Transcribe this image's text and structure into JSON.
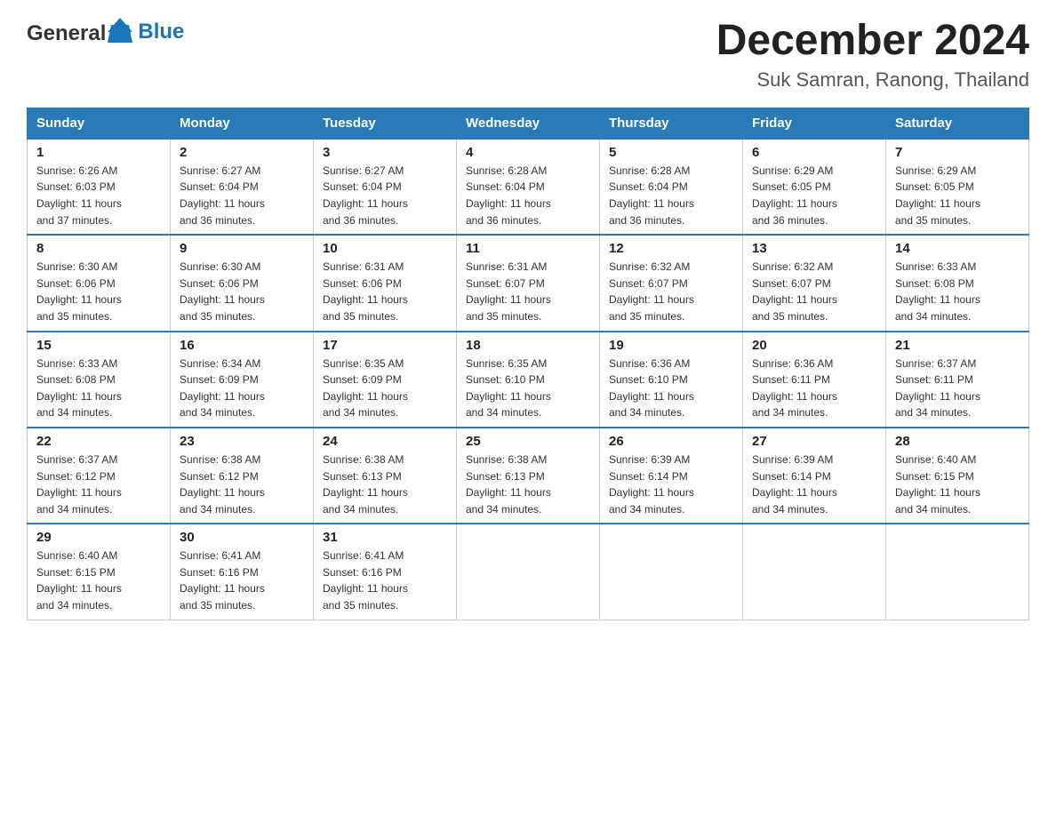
{
  "header": {
    "logo_general": "General",
    "logo_blue": "Blue",
    "title": "December 2024",
    "subtitle": "Suk Samran, Ranong, Thailand"
  },
  "days_of_week": [
    "Sunday",
    "Monday",
    "Tuesday",
    "Wednesday",
    "Thursday",
    "Friday",
    "Saturday"
  ],
  "weeks": [
    [
      {
        "day": "1",
        "sunrise": "6:26 AM",
        "sunset": "6:03 PM",
        "daylight": "11 hours and 37 minutes."
      },
      {
        "day": "2",
        "sunrise": "6:27 AM",
        "sunset": "6:04 PM",
        "daylight": "11 hours and 36 minutes."
      },
      {
        "day": "3",
        "sunrise": "6:27 AM",
        "sunset": "6:04 PM",
        "daylight": "11 hours and 36 minutes."
      },
      {
        "day": "4",
        "sunrise": "6:28 AM",
        "sunset": "6:04 PM",
        "daylight": "11 hours and 36 minutes."
      },
      {
        "day": "5",
        "sunrise": "6:28 AM",
        "sunset": "6:04 PM",
        "daylight": "11 hours and 36 minutes."
      },
      {
        "day": "6",
        "sunrise": "6:29 AM",
        "sunset": "6:05 PM",
        "daylight": "11 hours and 36 minutes."
      },
      {
        "day": "7",
        "sunrise": "6:29 AM",
        "sunset": "6:05 PM",
        "daylight": "11 hours and 35 minutes."
      }
    ],
    [
      {
        "day": "8",
        "sunrise": "6:30 AM",
        "sunset": "6:06 PM",
        "daylight": "11 hours and 35 minutes."
      },
      {
        "day": "9",
        "sunrise": "6:30 AM",
        "sunset": "6:06 PM",
        "daylight": "11 hours and 35 minutes."
      },
      {
        "day": "10",
        "sunrise": "6:31 AM",
        "sunset": "6:06 PM",
        "daylight": "11 hours and 35 minutes."
      },
      {
        "day": "11",
        "sunrise": "6:31 AM",
        "sunset": "6:07 PM",
        "daylight": "11 hours and 35 minutes."
      },
      {
        "day": "12",
        "sunrise": "6:32 AM",
        "sunset": "6:07 PM",
        "daylight": "11 hours and 35 minutes."
      },
      {
        "day": "13",
        "sunrise": "6:32 AM",
        "sunset": "6:07 PM",
        "daylight": "11 hours and 35 minutes."
      },
      {
        "day": "14",
        "sunrise": "6:33 AM",
        "sunset": "6:08 PM",
        "daylight": "11 hours and 34 minutes."
      }
    ],
    [
      {
        "day": "15",
        "sunrise": "6:33 AM",
        "sunset": "6:08 PM",
        "daylight": "11 hours and 34 minutes."
      },
      {
        "day": "16",
        "sunrise": "6:34 AM",
        "sunset": "6:09 PM",
        "daylight": "11 hours and 34 minutes."
      },
      {
        "day": "17",
        "sunrise": "6:35 AM",
        "sunset": "6:09 PM",
        "daylight": "11 hours and 34 minutes."
      },
      {
        "day": "18",
        "sunrise": "6:35 AM",
        "sunset": "6:10 PM",
        "daylight": "11 hours and 34 minutes."
      },
      {
        "day": "19",
        "sunrise": "6:36 AM",
        "sunset": "6:10 PM",
        "daylight": "11 hours and 34 minutes."
      },
      {
        "day": "20",
        "sunrise": "6:36 AM",
        "sunset": "6:11 PM",
        "daylight": "11 hours and 34 minutes."
      },
      {
        "day": "21",
        "sunrise": "6:37 AM",
        "sunset": "6:11 PM",
        "daylight": "11 hours and 34 minutes."
      }
    ],
    [
      {
        "day": "22",
        "sunrise": "6:37 AM",
        "sunset": "6:12 PM",
        "daylight": "11 hours and 34 minutes."
      },
      {
        "day": "23",
        "sunrise": "6:38 AM",
        "sunset": "6:12 PM",
        "daylight": "11 hours and 34 minutes."
      },
      {
        "day": "24",
        "sunrise": "6:38 AM",
        "sunset": "6:13 PM",
        "daylight": "11 hours and 34 minutes."
      },
      {
        "day": "25",
        "sunrise": "6:38 AM",
        "sunset": "6:13 PM",
        "daylight": "11 hours and 34 minutes."
      },
      {
        "day": "26",
        "sunrise": "6:39 AM",
        "sunset": "6:14 PM",
        "daylight": "11 hours and 34 minutes."
      },
      {
        "day": "27",
        "sunrise": "6:39 AM",
        "sunset": "6:14 PM",
        "daylight": "11 hours and 34 minutes."
      },
      {
        "day": "28",
        "sunrise": "6:40 AM",
        "sunset": "6:15 PM",
        "daylight": "11 hours and 34 minutes."
      }
    ],
    [
      {
        "day": "29",
        "sunrise": "6:40 AM",
        "sunset": "6:15 PM",
        "daylight": "11 hours and 34 minutes."
      },
      {
        "day": "30",
        "sunrise": "6:41 AM",
        "sunset": "6:16 PM",
        "daylight": "11 hours and 35 minutes."
      },
      {
        "day": "31",
        "sunrise": "6:41 AM",
        "sunset": "6:16 PM",
        "daylight": "11 hours and 35 minutes."
      },
      null,
      null,
      null,
      null
    ]
  ],
  "labels": {
    "sunrise": "Sunrise:",
    "sunset": "Sunset:",
    "daylight": "Daylight:"
  }
}
